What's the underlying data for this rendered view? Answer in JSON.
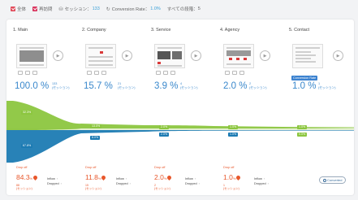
{
  "topbar": {
    "cb1_label": "全体",
    "cb2_label": "再訪問",
    "sessions_label": "セッション：",
    "sessions_value": "133",
    "conversion_label": "Conversion Rate：",
    "conversion_value": "1.0%",
    "all_steps_label": "すべての段階：",
    "all_steps_value": "5"
  },
  "steps": [
    {
      "title": "1. Main",
      "pct_whole": "100.0",
      "pct_sign": "%",
      "count": "133",
      "unit": "(セッション)"
    },
    {
      "title": "2. Company",
      "pct_whole": "15.7",
      "pct_sign": "%",
      "count": "21",
      "unit": "(セッション)"
    },
    {
      "title": "3. Service",
      "pct_whole": "3.9",
      "pct_sign": "%",
      "count": "4",
      "unit": "(セッション)"
    },
    {
      "title": "4. Agency",
      "pct_whole": "2.0",
      "pct_sign": "%",
      "count": "2",
      "unit": "(セッション)"
    },
    {
      "title": "5. Contact",
      "pct_whole": "1.0",
      "pct_sign": "%",
      "count": "1",
      "unit": "(セッション)",
      "badge": "Conversion Rate"
    }
  ],
  "flow_chips": {
    "s1_top": "32.3%",
    "s1_bottom": "67.8%",
    "s2_top": "13.0%",
    "s2_bottom": "8.0%",
    "s3_top": "2.0%",
    "s3_bottom": "2.0%",
    "s4_top": "1.0%",
    "s4_bottom": "1.0%",
    "s5_top": "1.0%",
    "s5_bottom": "0.0%"
  },
  "dropoffs": [
    {
      "label": "Drop off",
      "value": "84.3",
      "sign": "%",
      "count": "88",
      "unit": "(セッション)"
    },
    {
      "label": "Drop off",
      "value": "11.8",
      "sign": "%",
      "count": "15",
      "unit": "(セッション)"
    },
    {
      "label": "Drop off",
      "value": "2.0",
      "sign": "%",
      "count": "2",
      "unit": "(セッション)"
    },
    {
      "label": "Drop off",
      "value": "1.0",
      "sign": "%",
      "count": "1",
      "unit": "(セッション)"
    }
  ],
  "inflow_label": "Inflow",
  "dropped_label": "Dropped",
  "arrow_glyph": "›",
  "play_glyph": "▶",
  "converted_button": "Converted",
  "colors": {
    "accent_blue": "#3a88cc",
    "flow_green": "#8cc63f",
    "flow_blue": "#1c7bb3",
    "drop_orange": "#e8572b",
    "checkbox_red": "#e04b5a"
  }
}
